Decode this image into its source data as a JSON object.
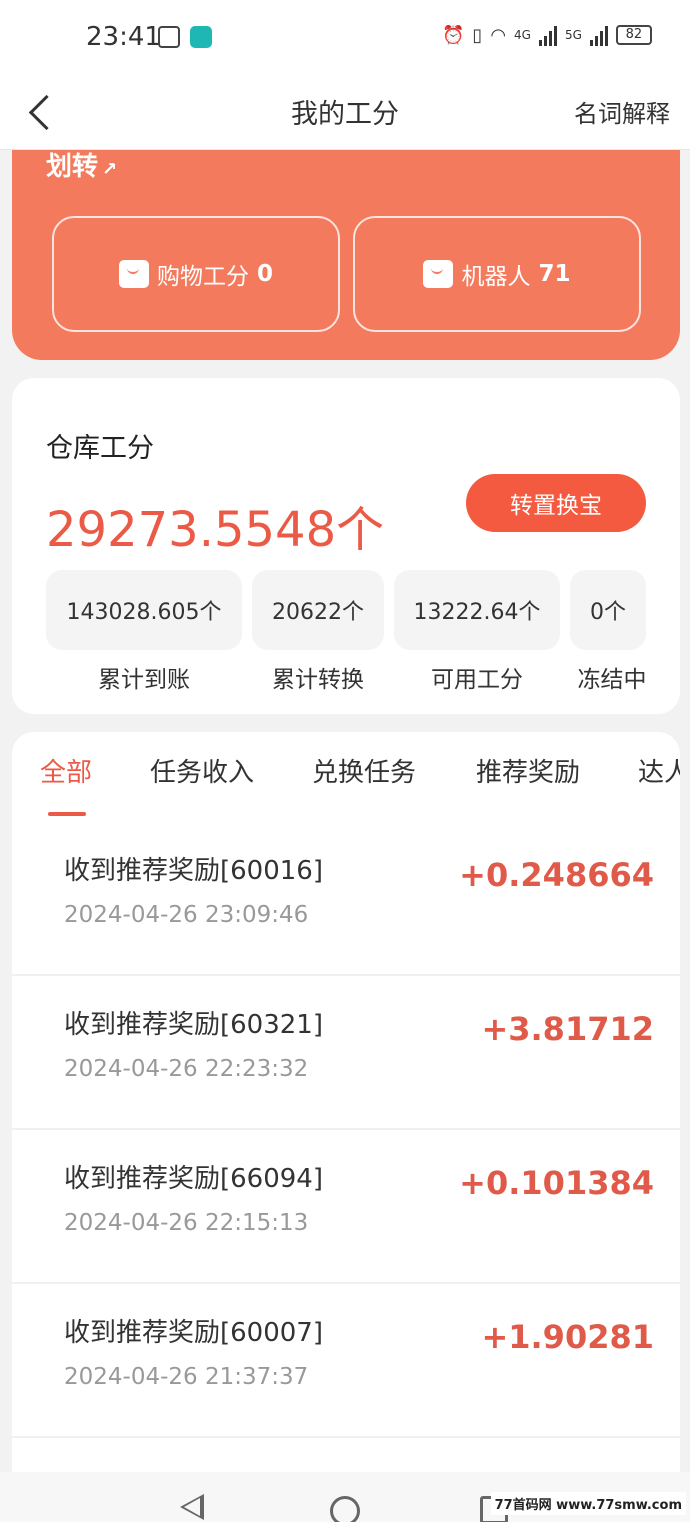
{
  "status_bar": {
    "time": "23:41",
    "network_4g": "4G",
    "network_5g": "5G",
    "battery": "82"
  },
  "header": {
    "title": "我的工分",
    "right_link": "名词解释"
  },
  "summary_card": {
    "transfer_label": "划转",
    "shopping_label": "购物工分",
    "shopping_value": "0",
    "robot_label": "机器人",
    "robot_value": "71"
  },
  "warehouse": {
    "title": "仓库工分",
    "amount": "29273.5548个",
    "convert_button": "转置换宝",
    "stats": [
      {
        "value": "143028.605个",
        "label": "累计到账"
      },
      {
        "value": "20622个",
        "label": "累计转换"
      },
      {
        "value": "13222.64个",
        "label": "可用工分"
      },
      {
        "value": "0个",
        "label": "冻结中"
      }
    ]
  },
  "tabs": [
    {
      "label": "全部",
      "active": true
    },
    {
      "label": "任务收入",
      "active": false
    },
    {
      "label": "兑换任务",
      "active": false
    },
    {
      "label": "推荐奖励",
      "active": false
    },
    {
      "label": "达人",
      "active": false
    }
  ],
  "transactions": [
    {
      "title": "收到推荐奖励[60016]",
      "time": "2024-04-26 23:09:46",
      "amount": "+0.248664"
    },
    {
      "title": "收到推荐奖励[60321]",
      "time": "2024-04-26 22:23:32",
      "amount": "+3.81712"
    },
    {
      "title": "收到推荐奖励[66094]",
      "time": "2024-04-26 22:15:13",
      "amount": "+0.101384"
    },
    {
      "title": "收到推荐奖励[60007]",
      "time": "2024-04-26 21:37:37",
      "amount": "+1.90281"
    }
  ],
  "watermark": "77首码网 www.77smw.com"
}
